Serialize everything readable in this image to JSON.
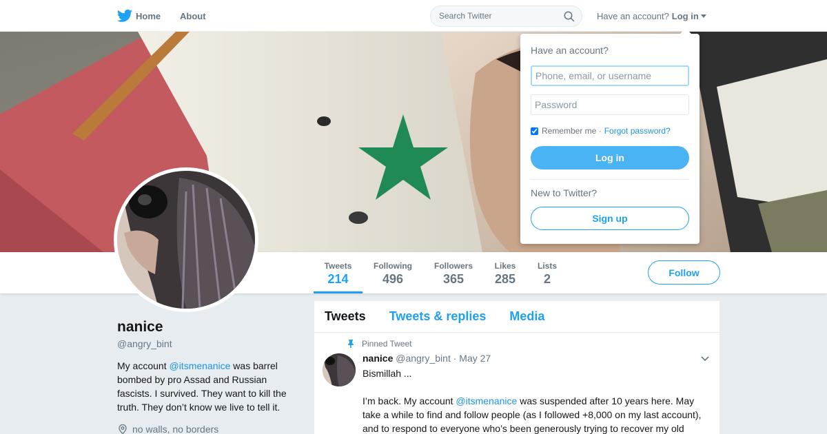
{
  "nav": {
    "home_label": "Home",
    "about_label": "About",
    "search_placeholder": "Search Twitter",
    "have_account_text": "Have an account?",
    "login_label": "Log in"
  },
  "profile": {
    "name": "nanice",
    "handle": "@angry_bint",
    "bio_before": "My account ",
    "bio_mention": "@itsmenanice",
    "bio_after": " was barrel bombed by pro Assad and Russian fascists. I survived. They want to kill the truth. They don’t know we live to tell it.",
    "location": "no walls, no borders"
  },
  "stats": [
    {
      "label": "Tweets",
      "value": "214",
      "active": true
    },
    {
      "label": "Following",
      "value": "496"
    },
    {
      "label": "Followers",
      "value": "365"
    },
    {
      "label": "Likes",
      "value": "285"
    },
    {
      "label": "Lists",
      "value": "2"
    }
  ],
  "follow_label": "Follow",
  "timeline": {
    "tabs": [
      "Tweets",
      "Tweets & replies",
      "Media"
    ],
    "pinned_label": "Pinned Tweet",
    "tweet": {
      "name": "nanice",
      "handle": "@angry_bint",
      "date": "· May 27",
      "line1": "Bismillah ...",
      "line2_before": "I’m back. My account ",
      "line2_mention": "@itsmenanice",
      "line2_after": " was suspended after 10 years here. May take a while to find and follow people (as I followed +8,000 on my last account), and to respond to everyone who’s been generously trying to recover my old"
    }
  },
  "login_dropdown": {
    "title": "Have an account?",
    "username_placeholder": "Phone, email, or username",
    "password_placeholder": "Password",
    "remember_label": "Remember me ·",
    "forgot_label": "Forgot password?",
    "remember_checked": true,
    "login_button": "Log in",
    "new_text": "New to Twitter?",
    "signup_button": "Sign up"
  },
  "colors": {
    "accent": "#1da1f2",
    "text_secondary": "#66757f",
    "background": "#e6ecf0"
  }
}
